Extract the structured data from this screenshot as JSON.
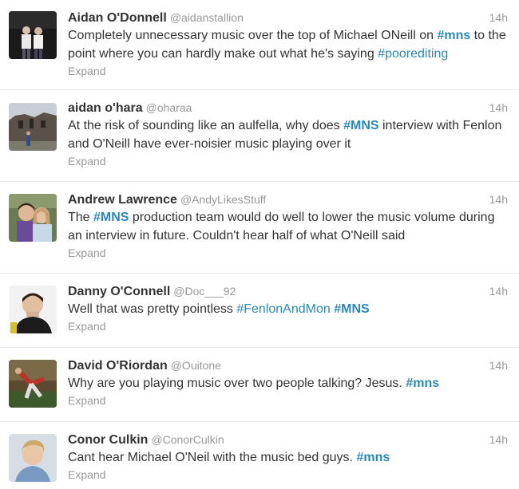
{
  "tweets": [
    {
      "name": "Aidan O'Donnell",
      "handle": "@aidanstallion",
      "time": "14h",
      "segments": [
        {
          "t": "Completely unnecessary music over the top of Michael ONeill on "
        },
        {
          "t": "#mns",
          "tag": true,
          "bold": true
        },
        {
          "t": " to the point where you can hardly make out what he's saying "
        },
        {
          "t": "#poorediting",
          "tag": true
        }
      ],
      "expand": "Expand",
      "avatar_icon": "two-people-photo"
    },
    {
      "name": "aidan o'hara",
      "handle": "@oharaa",
      "time": "14h",
      "segments": [
        {
          "t": "At the risk of sounding like an aulfella, why does "
        },
        {
          "t": "#MNS",
          "tag": true,
          "bold": true
        },
        {
          "t": " interview with Fenlon and O'Neill have ever-noisier music playing over it"
        }
      ],
      "expand": "Expand",
      "avatar_icon": "castle-ruin-photo"
    },
    {
      "name": "Andrew Lawrence",
      "handle": "@AndyLikesStuff",
      "time": "14h",
      "segments": [
        {
          "t": "The "
        },
        {
          "t": "#MNS",
          "tag": true,
          "bold": true
        },
        {
          "t": " production team would do well to lower the music volume during an interview in future. Couldn't hear half of what O'Neill said"
        }
      ],
      "expand": "Expand",
      "avatar_icon": "couple-photo"
    },
    {
      "name": "Danny O'Connell",
      "handle": "@Doc___92",
      "time": "14h",
      "segments": [
        {
          "t": "Well that was pretty pointless "
        },
        {
          "t": "#FenlonAndMon",
          "tag": true
        },
        {
          "t": " "
        },
        {
          "t": "#MNS",
          "tag": true,
          "bold": true
        }
      ],
      "expand": "Expand",
      "avatar_icon": "young-man-photo"
    },
    {
      "name": "David O'Riordan",
      "handle": "@Ouitone",
      "time": "14h",
      "segments": [
        {
          "t": "Why are you playing music over two people talking? Jesus. "
        },
        {
          "t": "#mns",
          "tag": true,
          "bold": true
        }
      ],
      "expand": "Expand",
      "avatar_icon": "action-figure-photo"
    },
    {
      "name": "Conor Culkin",
      "handle": "@ConorCulkin",
      "time": "14h",
      "segments": [
        {
          "t": "Cant hear Michael O'Neil with the music bed guys. "
        },
        {
          "t": "#mns",
          "tag": true,
          "bold": true
        }
      ],
      "expand": "Expand",
      "avatar_icon": "blond-man-photo"
    }
  ],
  "colors": {
    "hashtag": "#2a88b8",
    "muted": "#999999",
    "text": "#333333",
    "divider": "#e8e8e8"
  }
}
